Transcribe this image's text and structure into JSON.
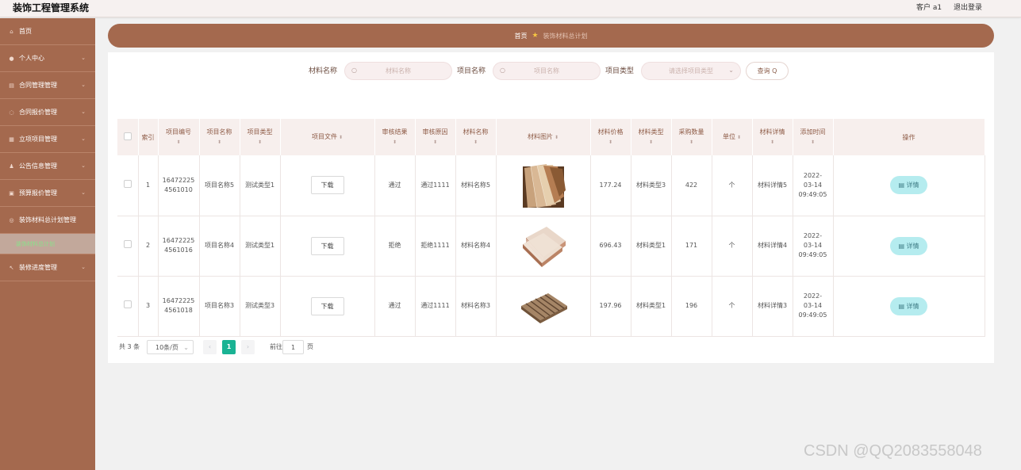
{
  "header": {
    "title": "装饰工程管理系统",
    "user": "客户 a1",
    "logout": "退出登录"
  },
  "sidebar": {
    "items": [
      {
        "label": "首页",
        "icon": "home-icon"
      },
      {
        "label": "个人中心",
        "icon": "user-icon"
      },
      {
        "label": "合同管理管理",
        "icon": "contract-icon"
      },
      {
        "label": "合同报价管理",
        "icon": "quote-icon"
      },
      {
        "label": "立项项目管理",
        "icon": "project-icon"
      },
      {
        "label": "公告信息管理",
        "icon": "notice-icon"
      },
      {
        "label": "预算报价管理",
        "icon": "budget-icon"
      },
      {
        "label": "装饰材料总计划管理",
        "icon": "material-icon"
      },
      {
        "label": "装修进度管理",
        "icon": "progress-icon"
      }
    ],
    "active_sub": "装饰材料总计划"
  },
  "breadcrumb": {
    "home": "首页",
    "current": "装饰材料总计划"
  },
  "search": {
    "material_name_label": "材料名称",
    "material_name_placeholder": "材料名称",
    "project_name_label": "项目名称",
    "project_name_placeholder": "项目名称",
    "project_type_label": "项目类型",
    "project_type_placeholder": "请选择项目类型",
    "query_button": "查询 Q"
  },
  "table": {
    "headers": {
      "index": "索引",
      "project_no": "项目编号",
      "project_name": "项目名称",
      "project_type": "项目类型",
      "project_file": "项目文件",
      "review_result": "审核结果",
      "review_reason": "审核原因",
      "material_name": "材料名称",
      "material_image": "材料图片",
      "material_price": "材料价格",
      "material_type": "材料类型",
      "purchase_qty": "采购数量",
      "unit": "单位",
      "material_detail": "材料详情",
      "add_time": "添加时间",
      "actions": "操作"
    },
    "download_label": "下载",
    "detail_label": "详情",
    "rows": [
      {
        "index": "1",
        "project_no": "164722254561010",
        "project_name": "项目名称5",
        "project_type": "测试类型1",
        "review_result": "通过",
        "review_reason": "通过1111",
        "material_name": "材料名称5",
        "image": "wood-sample-fan",
        "price": "177.24",
        "material_type": "材料类型3",
        "qty": "422",
        "unit": "个",
        "detail": "材料详情5",
        "add_time": "2022-03-14 09:49:05"
      },
      {
        "index": "2",
        "project_no": "164722254561016",
        "project_name": "项目名称4",
        "project_type": "测试类型1",
        "review_result": "拒绝",
        "review_reason": "拒绝1111",
        "material_name": "材料名称4",
        "image": "stacked-boards",
        "price": "696.43",
        "material_type": "材料类型1",
        "qty": "171",
        "unit": "个",
        "detail": "材料详情4",
        "add_time": "2022-03-14 09:49:05"
      },
      {
        "index": "3",
        "project_no": "164722254561018",
        "project_name": "项目名称3",
        "project_type": "测试类型3",
        "review_result": "通过",
        "review_reason": "通过1111",
        "material_name": "材料名称3",
        "image": "grooved-panel",
        "price": "197.96",
        "material_type": "材料类型1",
        "qty": "196",
        "unit": "个",
        "detail": "材料详情3",
        "add_time": "2022-03-14 09:49:05"
      }
    ]
  },
  "pagination": {
    "total": "共 3 条",
    "page_size": "10条/页",
    "current_page": "1",
    "goto_label": "前往",
    "goto_value": "1",
    "page_suffix": "页"
  },
  "watermark": "CSDN @QQ2083558048",
  "colors": {
    "sidebar": "#a4694e",
    "accent_green": "#1ab394",
    "detail_button": "#b5ecef"
  }
}
